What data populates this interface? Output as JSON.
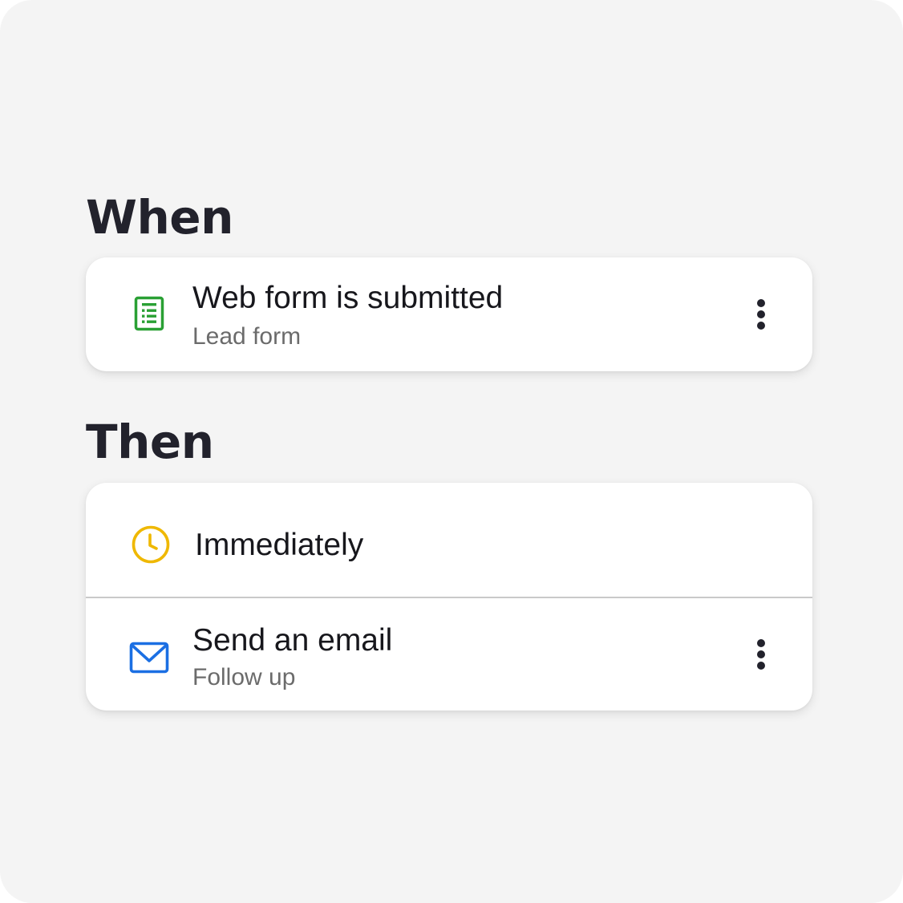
{
  "when": {
    "heading": "When",
    "trigger": {
      "icon": "form-document-icon",
      "icon_color": "#2aa034",
      "title": "Web form is submitted",
      "subtitle": "Lead form"
    }
  },
  "then": {
    "heading": "Then",
    "delay": {
      "icon": "clock-icon",
      "icon_color": "#efb800",
      "label": "Immediately"
    },
    "action": {
      "icon": "envelope-icon",
      "icon_color": "#1b6fe3",
      "title": "Send an email",
      "subtitle": "Follow up"
    }
  }
}
